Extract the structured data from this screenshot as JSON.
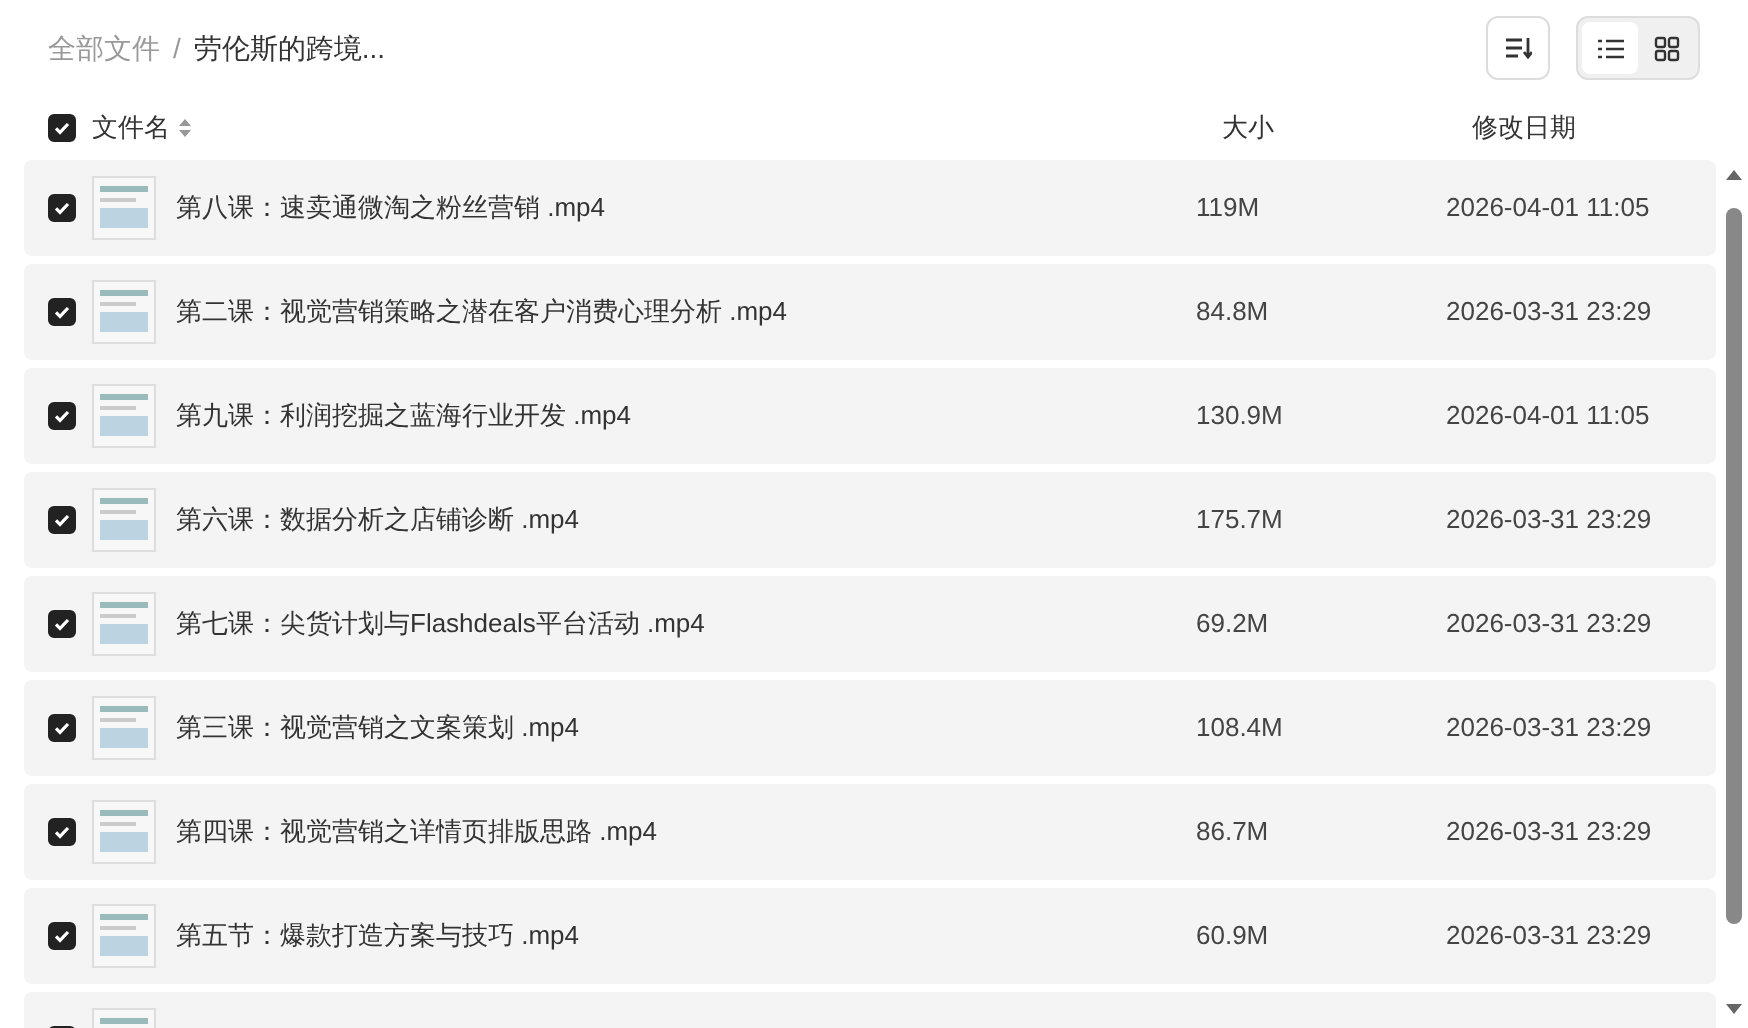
{
  "breadcrumb": [
    {
      "label": "全部文件",
      "current": false
    },
    {
      "label": "劳伦斯的跨境...",
      "current": true
    }
  ],
  "separator": "/",
  "view_toggle": [
    {
      "kind": "list",
      "selected": true
    },
    {
      "kind": "grid",
      "selected": false
    }
  ],
  "header": {
    "checked": true,
    "columns": [
      "文件名",
      "大小",
      "修改日期"
    ]
  },
  "files": [
    {
      "checked": true,
      "name": "第八课：速卖通微淘之粉丝营销 .mp4",
      "size": "119M",
      "date": "2026-04-01 11:05"
    },
    {
      "checked": true,
      "name": "第二课：视觉营销策略之潜在客户消费心理分析 .mp4",
      "size": "84.8M",
      "date": "2026-03-31 23:29"
    },
    {
      "checked": true,
      "name": "第九课：利润挖掘之蓝海行业开发 .mp4",
      "size": "130.9M",
      "date": "2026-04-01 11:05"
    },
    {
      "checked": true,
      "name": "第六课：数据分析之店铺诊断 .mp4",
      "size": "175.7M",
      "date": "2026-03-31 23:29"
    },
    {
      "checked": true,
      "name": "第七课：尖货计划与Flashdeals平台活动 .mp4",
      "size": "69.2M",
      "date": "2026-03-31 23:29"
    },
    {
      "checked": true,
      "name": "第三课：视觉营销之文案策划 .mp4",
      "size": "108.4M",
      "date": "2026-03-31 23:29"
    },
    {
      "checked": true,
      "name": "第四课：视觉营销之详情页排版思路 .mp4",
      "size": "86.7M",
      "date": "2026-03-31 23:29"
    },
    {
      "checked": true,
      "name": "第五节：爆款打造方案与技巧 .mp4",
      "size": "60.9M",
      "date": "2026-03-31 23:29"
    },
    {
      "checked": true
    }
  ]
}
